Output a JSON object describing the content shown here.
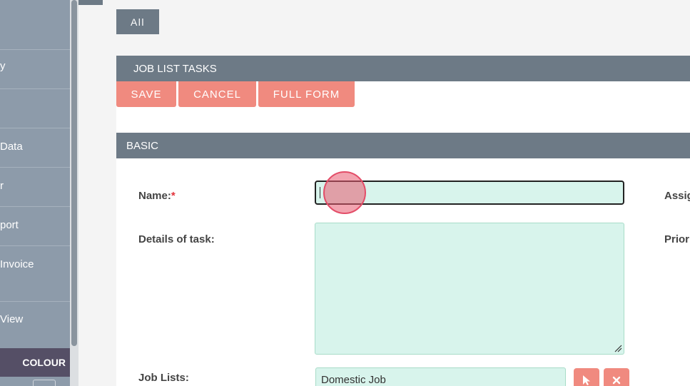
{
  "sidebar": {
    "items": [
      {
        "label": ""
      },
      {
        "label": "y"
      },
      {
        "label": ""
      },
      {
        "label": " Data"
      },
      {
        "label": "r"
      },
      {
        "label": "port"
      },
      {
        "label": " Invoice"
      },
      {
        "label": " View"
      }
    ],
    "colour_label": "COLOUR"
  },
  "filter_tab": {
    "label": "All"
  },
  "panel": {
    "title": "JOB LIST TASKS"
  },
  "buttons": {
    "save": "SAVE",
    "cancel": "CANCEL",
    "full_form": "FULL FORM"
  },
  "section": {
    "title": "BASIC"
  },
  "form": {
    "name_label": "Name:",
    "required_mark": "*",
    "name_value": "",
    "details_label": "Details of task:",
    "job_lists_label": "Job Lists:",
    "job_lists_value": "Domestic Job",
    "assigned_label": "Assig",
    "priority_label": "Prior"
  },
  "colors": {
    "sidebar": "#8d9baa",
    "header": "#6d7a86",
    "accent_button": "#f08a7f",
    "input_bg": "#d8f4ec",
    "colour_bar": "#554f66"
  },
  "icons": {
    "select": "cursor-arrow-icon",
    "clear": "close-x-icon"
  }
}
